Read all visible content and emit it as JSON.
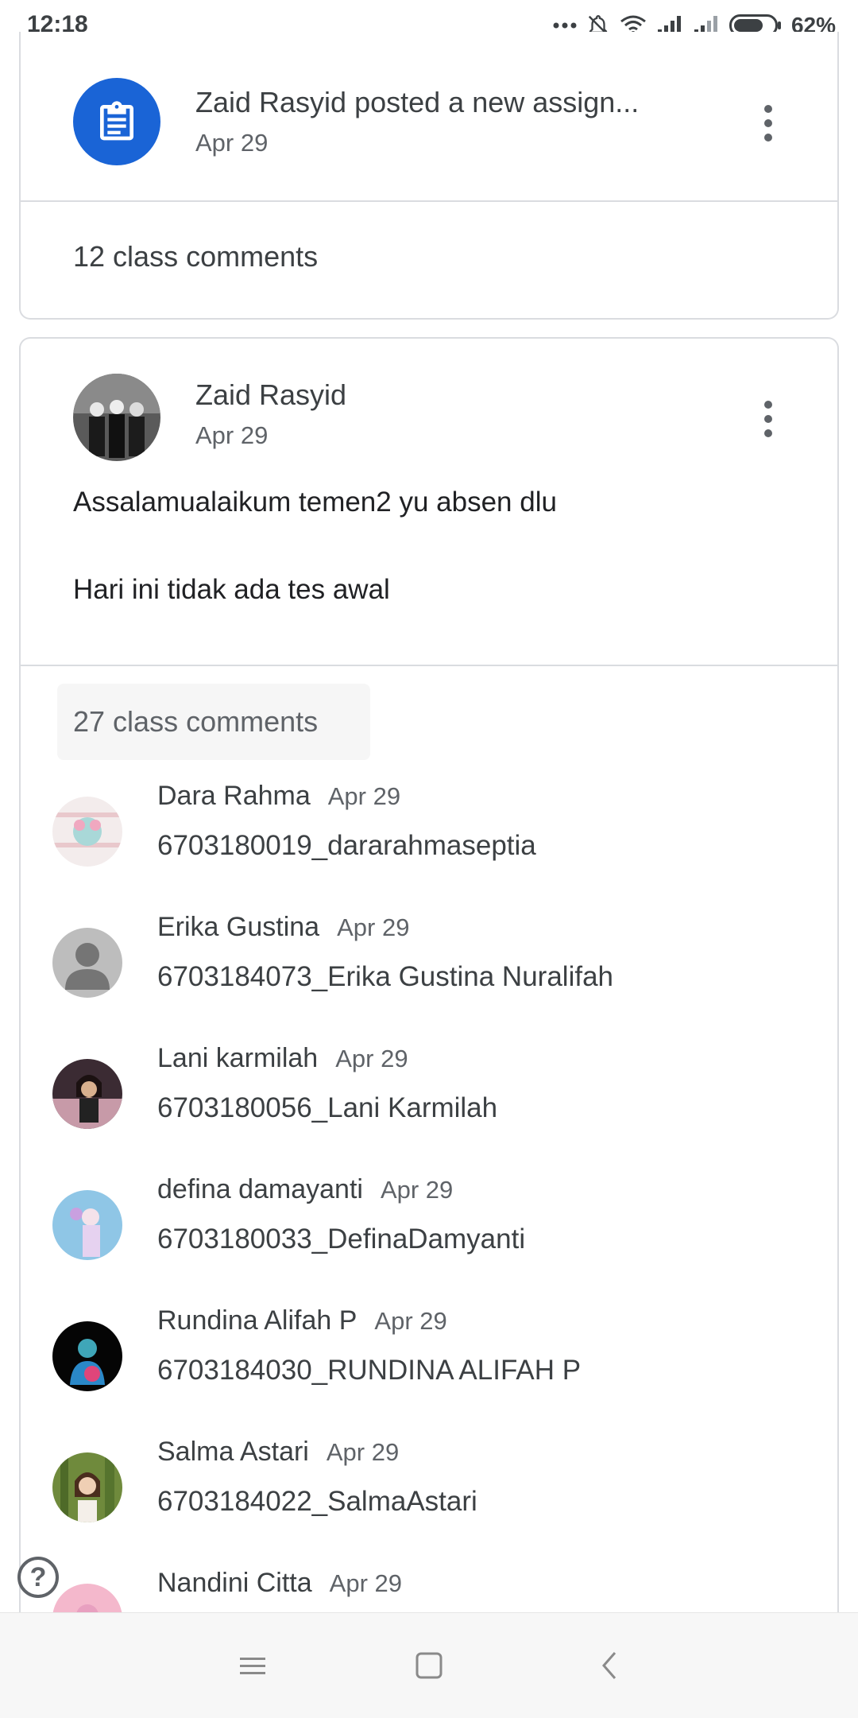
{
  "status_bar": {
    "time": "12:18",
    "battery": "62%"
  },
  "assignment_card": {
    "title": "Zaid Rasyid posted a new assign...",
    "date": "Apr 29",
    "comments_label": "12 class comments",
    "icon": "assignment-icon",
    "accent": "#1a64d6"
  },
  "post_card": {
    "author": "Zaid Rasyid",
    "date": "Apr 29",
    "body_line1": "Assalamualaikum temen2 yu absen dlu",
    "body_line2": "Hari ini tidak ada tes awal",
    "comments_label": "27 class comments"
  },
  "comments": [
    {
      "name": "Dara Rahma",
      "date": "Apr 29",
      "text": "6703180019_dararahmaseptia",
      "avatar": "avatar-dara"
    },
    {
      "name": "Erika Gustina",
      "date": "Apr 29",
      "text": "6703184073_Erika Gustina Nuralifah",
      "avatar": "default-avatar"
    },
    {
      "name": "Lani karmilah",
      "date": "Apr 29",
      "text": "6703180056_Lani Karmilah",
      "avatar": "avatar-lani"
    },
    {
      "name": "defina damayanti",
      "date": "Apr 29",
      "text": "6703180033_DefinaDamyanti",
      "avatar": "avatar-defina"
    },
    {
      "name": "Rundina Alifah P",
      "date": "Apr 29",
      "text": "6703184030_RUNDINA ALIFAH P",
      "avatar": "avatar-rundina"
    },
    {
      "name": "Salma Astari",
      "date": "Apr 29",
      "text": "6703184022_SalmaAstari",
      "avatar": "avatar-salma"
    },
    {
      "name": "Nandini Citta",
      "date": "Apr 29",
      "text": "",
      "avatar": "avatar-nandini"
    }
  ],
  "help": {
    "label": "?"
  }
}
